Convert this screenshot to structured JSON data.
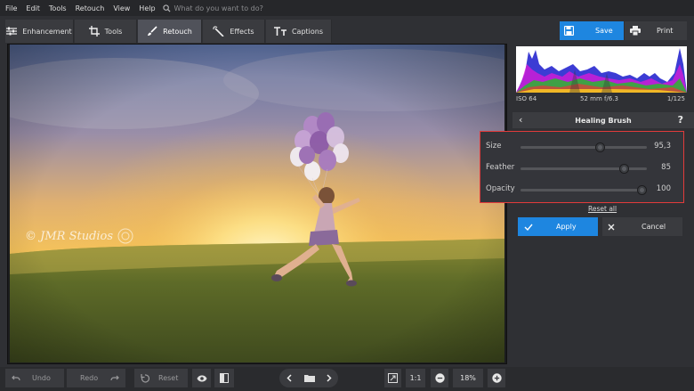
{
  "menu": {
    "items": [
      "File",
      "Edit",
      "Tools",
      "Retouch",
      "View",
      "Help"
    ],
    "search_placeholder": "What do you want to do?"
  },
  "tabs": [
    {
      "label": "Enhancement",
      "icon": "sliders-icon"
    },
    {
      "label": "Tools",
      "icon": "crop-icon"
    },
    {
      "label": "Retouch",
      "icon": "brush-icon",
      "active": true
    },
    {
      "label": "Effects",
      "icon": "magic-wand-icon"
    },
    {
      "label": "Captions",
      "icon": "text-icon"
    }
  ],
  "actions": {
    "save": "Save",
    "print": "Print"
  },
  "exif": {
    "iso": "ISO 64",
    "lens": "52 mm f/6.3",
    "shutter": "1/125"
  },
  "tool_panel": {
    "title": "Healing Brush",
    "back_icon": "chevron-left-icon",
    "help": "?",
    "sliders": [
      {
        "label": "Size",
        "value": "95,3",
        "level": 0.63
      },
      {
        "label": "Feather",
        "value": "85",
        "level": 0.82
      },
      {
        "label": "Opacity",
        "value": "100",
        "level": 0.96
      }
    ],
    "reset_all": "Reset all",
    "apply": "Apply",
    "cancel": "Cancel"
  },
  "photo": {
    "watermark": "© JMR Studios"
  },
  "bottom": {
    "undo": "Undo",
    "redo": "Redo",
    "reset": "Reset",
    "ratio": "1:1",
    "zoom": "18%"
  },
  "colors": {
    "accent": "#1e86e0",
    "highlight_border": "#e23b3b",
    "panel_bg": "#2f3034"
  }
}
